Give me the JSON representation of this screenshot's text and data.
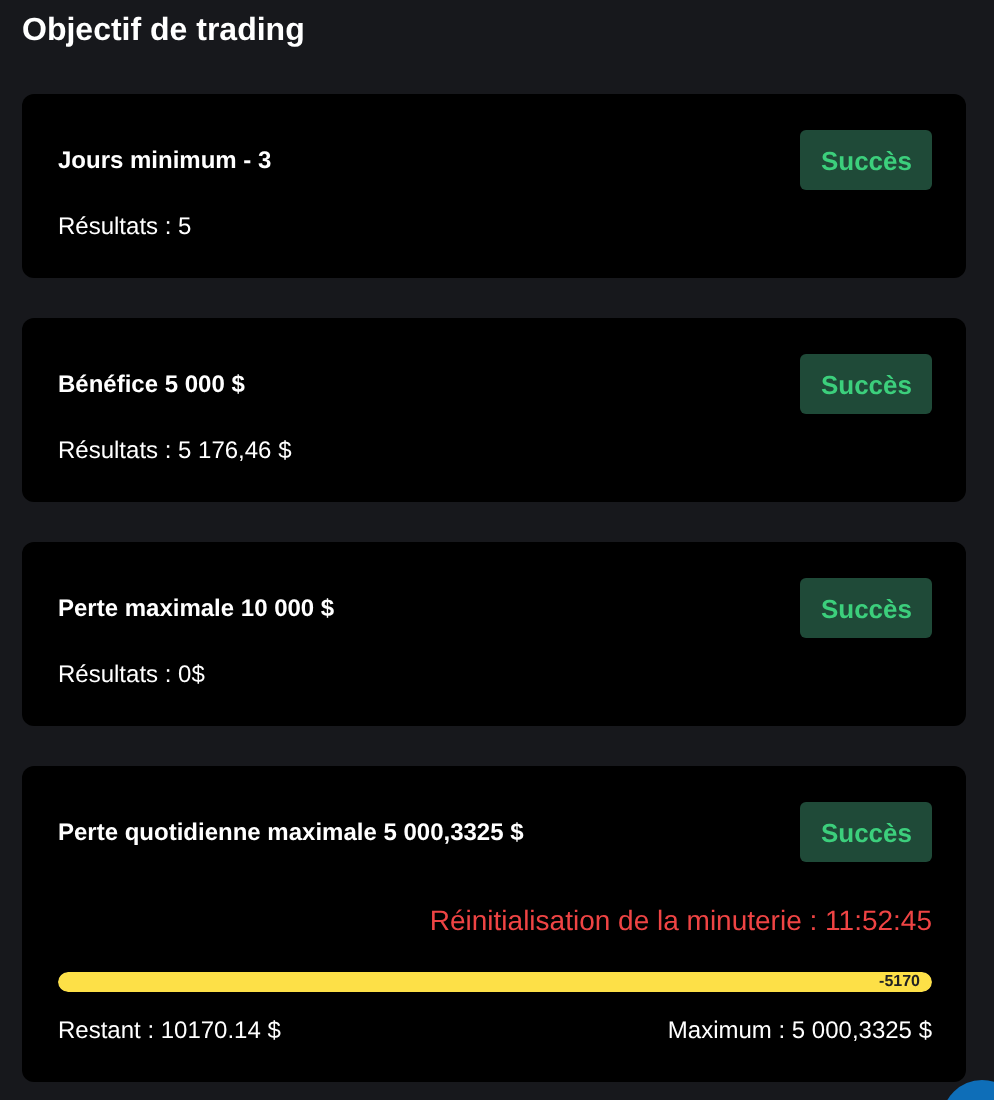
{
  "title": "Objectif de trading",
  "objectives": [
    {
      "kind": "basic",
      "title": "Jours minimum - 3",
      "status": "Succès",
      "result": "Résultats : 5"
    },
    {
      "kind": "basic",
      "title": "Bénéfice 5 000 $",
      "status": "Succès",
      "result": "Résultats : 5 176,46 $"
    },
    {
      "kind": "basic",
      "title": "Perte maximale 10 000 $",
      "status": "Succès",
      "result": "Résultats : 0$"
    },
    {
      "kind": "daily",
      "title": "Perte quotidienne maximale 5 000,3325 $",
      "status": "Succès",
      "timer": "Réinitialisation de la minuterie : 11:52:45",
      "level": 1,
      "bar_label": "-5170",
      "remaining": "Restant : 10170.14 $",
      "maximum": "Maximum : 5 000,3325 $"
    }
  ]
}
